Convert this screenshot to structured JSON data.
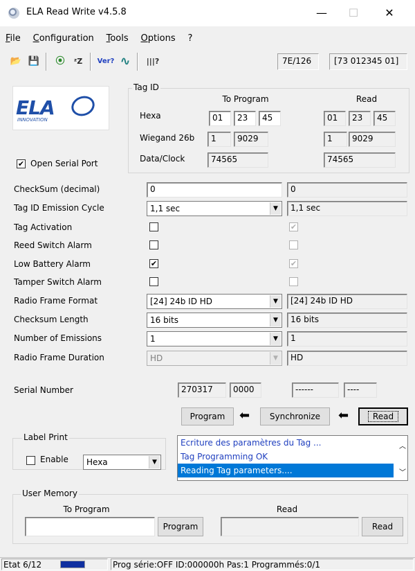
{
  "window": {
    "title": "ELA Read Write v4.5.8",
    "controls": {
      "minimize": "—",
      "maximize": "☐",
      "close": "✕"
    }
  },
  "menu": [
    {
      "label": "File",
      "accel": "F",
      "rest": "ile"
    },
    {
      "label": "Configuration",
      "accel": "C",
      "rest": "onfiguration"
    },
    {
      "label": "Tools",
      "accel": "T",
      "rest": "ools"
    },
    {
      "label": "Options",
      "accel": "O",
      "rest": "ptions"
    },
    {
      "label": "?",
      "accel": "",
      "rest": "?"
    }
  ],
  "toolbar": {
    "icons": [
      "open-file-icon",
      "save-file-icon",
      "radio-antenna-icon",
      "sleep-icon",
      "version-icon",
      "signal-wave-icon",
      "barcode-icon"
    ],
    "glyphs": [
      "📂",
      "💾",
      "⦿",
      "ᶻZ",
      "Ver?",
      "∿",
      "|||?"
    ],
    "status_left": "7E/126",
    "status_right": "[73 012345 01]"
  },
  "logo": {
    "text": "ELA",
    "subtext": "INNOVATION"
  },
  "open_serial_port": {
    "label": "Open Serial Port",
    "checked": true
  },
  "tag_id": {
    "title": "Tag ID",
    "to_program_header": "To Program",
    "read_header": "Read",
    "hexa_label": "Hexa",
    "wiegand_label": "Wiegand 26b",
    "dataclock_label": "Data/Clock",
    "prog_hexa": [
      "01",
      "23",
      "45"
    ],
    "read_hexa": [
      "01",
      "23",
      "45"
    ],
    "prog_wiegand": [
      "1",
      "9029"
    ],
    "read_wiegand": [
      "1",
      "9029"
    ],
    "prog_dataclock": "74565",
    "read_dataclock": "74565"
  },
  "params": [
    {
      "label": "CheckSum (decimal)",
      "type": "text",
      "prog": "0",
      "read": "0"
    },
    {
      "label": "Tag ID Emission Cycle",
      "type": "combo",
      "prog": "1,1 sec",
      "read": "1,1 sec"
    },
    {
      "label": "Tag Activation",
      "type": "check",
      "prog": false,
      "read": true
    },
    {
      "label": "Reed Switch Alarm",
      "type": "check",
      "prog": false,
      "read": false
    },
    {
      "label": "Low Battery Alarm",
      "type": "check",
      "prog": true,
      "read": true
    },
    {
      "label": "Tamper Switch Alarm",
      "type": "check",
      "prog": false,
      "read": false
    },
    {
      "label": "Radio Frame Format",
      "type": "combo",
      "prog": "[24] 24b ID HD",
      "read": "[24] 24b ID HD"
    },
    {
      "label": "Checksum Length",
      "type": "combo",
      "prog": "16 bits",
      "read": "16 bits"
    },
    {
      "label": "Number of Emissions",
      "type": "combo",
      "prog": "1",
      "read": "1"
    },
    {
      "label": "Radio Frame Duration",
      "type": "combo-disabled",
      "prog": "HD",
      "read": "HD"
    }
  ],
  "serial": {
    "label": "Serial Number",
    "prog": [
      "270317",
      "0000"
    ],
    "read": [
      "------",
      "----"
    ]
  },
  "actions": {
    "program": "Program",
    "synchronize": "Synchronize",
    "read": "Read",
    "arrow": "⬅"
  },
  "label_print": {
    "title": "Label Print",
    "enable_label": "Enable",
    "enabled": false,
    "format": "Hexa"
  },
  "log": {
    "lines": [
      "Ecriture des paramètres du Tag ...",
      "Tag Programming OK",
      "Reading Tag parameters...."
    ],
    "selected_index": 2
  },
  "user_memory": {
    "title": "User Memory",
    "to_program_header": "To Program",
    "read_header": "Read",
    "program_button": "Program",
    "read_button": "Read",
    "prog_value": "",
    "read_value": ""
  },
  "status": {
    "state": "Etat 6/12",
    "progress": 1,
    "info": "Prog série:OFF  ID:000000h  Pas:1  Programmés:0/1"
  },
  "colors": {
    "window_bg": "#f0f0f0",
    "log_text": "#1f3fbf",
    "selection": "#0078d7",
    "progress": "#1030a0",
    "logo_blue": "#1f4fa8"
  }
}
